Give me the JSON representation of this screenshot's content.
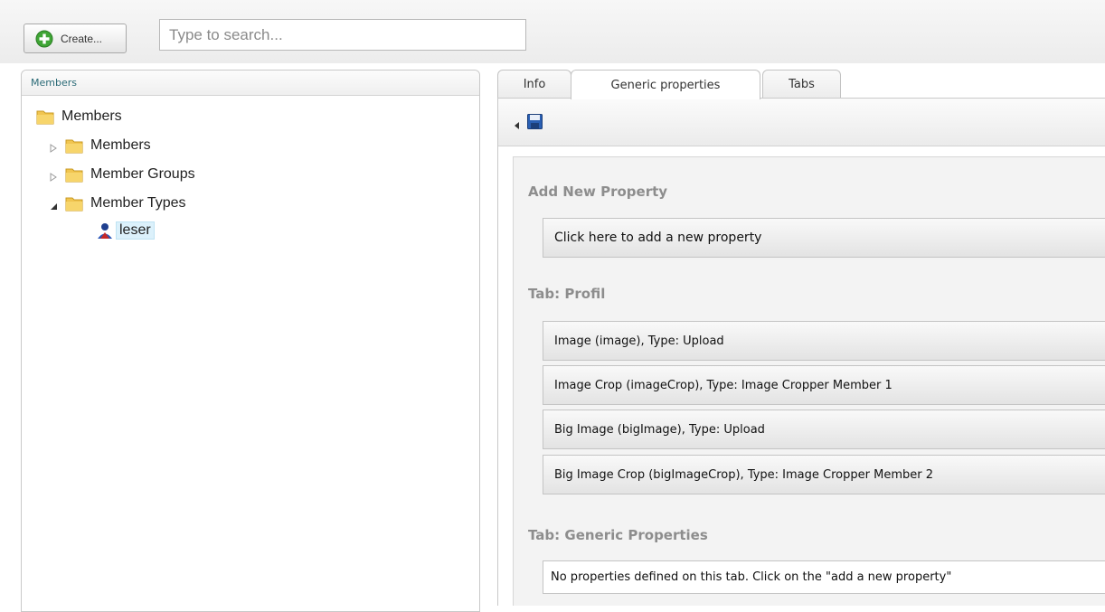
{
  "toolbar": {
    "create_label": "Create...",
    "search_placeholder": "Type to search..."
  },
  "tree": {
    "header": "Members",
    "root": "Members",
    "items": [
      {
        "label": "Members"
      },
      {
        "label": "Member Groups"
      },
      {
        "label": "Member Types"
      }
    ],
    "selected": "leser"
  },
  "tabs": [
    {
      "label": "Info"
    },
    {
      "label": "Generic properties",
      "active": true
    },
    {
      "label": "Tabs"
    }
  ],
  "content": {
    "add_section_title": "Add New Property",
    "add_property_label": "Click here to add a new property",
    "profil_section_title": "Tab: Profil",
    "profil_properties": [
      "Image (image), Type: Upload",
      "Image Crop (imageCrop), Type: Image Cropper Member 1",
      "Big Image (bigImage), Type: Upload",
      "Big Image Crop (bigImageCrop), Type: Image Cropper Member 2"
    ],
    "generic_section_title": "Tab: Generic Properties",
    "no_properties_text": "No properties defined on this tab. Click on the \"add a new property\""
  },
  "colors": {
    "accent_header": "#2b6b77",
    "selected_bg": "#dcf1fb",
    "section_title": "#8d8d8d",
    "create_icon": "#3fa535",
    "save_icon": "#2a5fb3"
  },
  "icons": {
    "create": "plus-circle-icon",
    "folder": "folder-icon",
    "member_type": "user-icon",
    "save": "floppy-disk-icon",
    "expand": "triangle-right-icon",
    "collapse": "triangle-down-icon"
  }
}
